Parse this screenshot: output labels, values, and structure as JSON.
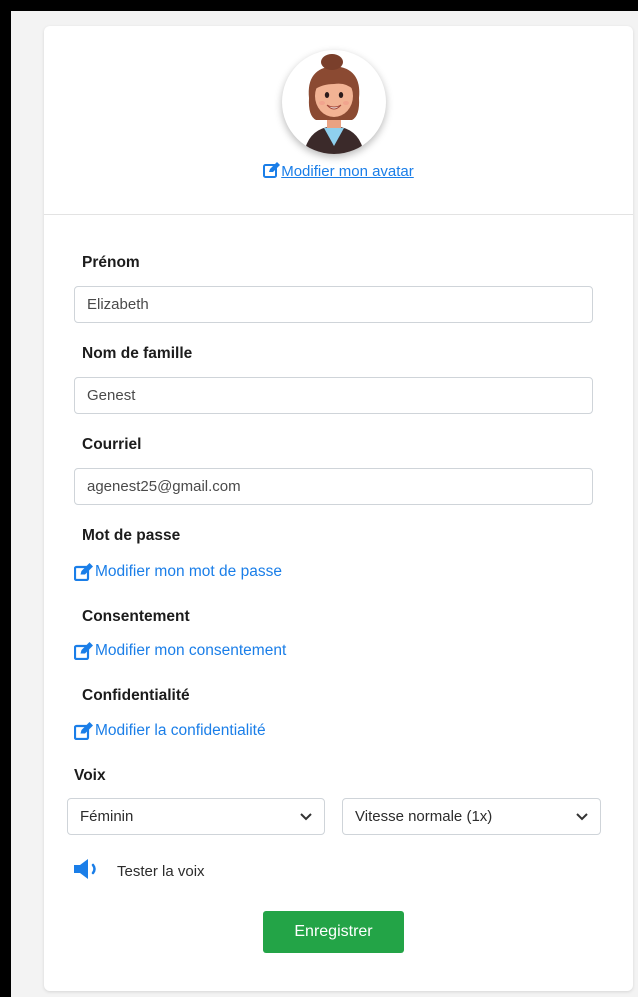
{
  "profile": {
    "avatar_link": "Modifier mon avatar",
    "first_name": {
      "label": "Prénom",
      "value": "Elizabeth"
    },
    "last_name": {
      "label": "Nom de famille",
      "value": "Genest"
    },
    "email": {
      "label": "Courriel",
      "value": "agenest25@gmail.com"
    },
    "password": {
      "label": "Mot de passe",
      "link": "Modifier mon mot de passe"
    },
    "consent": {
      "label": "Consentement",
      "link": "Modifier mon consentement"
    },
    "privacy": {
      "label": "Confidentialité",
      "link": "Modifier la confidentialité"
    },
    "voice": {
      "label": "Voix",
      "gender_selected": "Féminin",
      "speed_selected": "Vitesse normale (1x)",
      "test_label": "Tester la voix"
    },
    "save_label": "Enregistrer"
  },
  "icons": {
    "edit": "edit-icon",
    "speaker": "speaker-icon",
    "chevron": "chevron-down-icon"
  },
  "colors": {
    "link": "#1a7ee8",
    "save_button": "#23a447",
    "background": "#f3f3f3"
  }
}
